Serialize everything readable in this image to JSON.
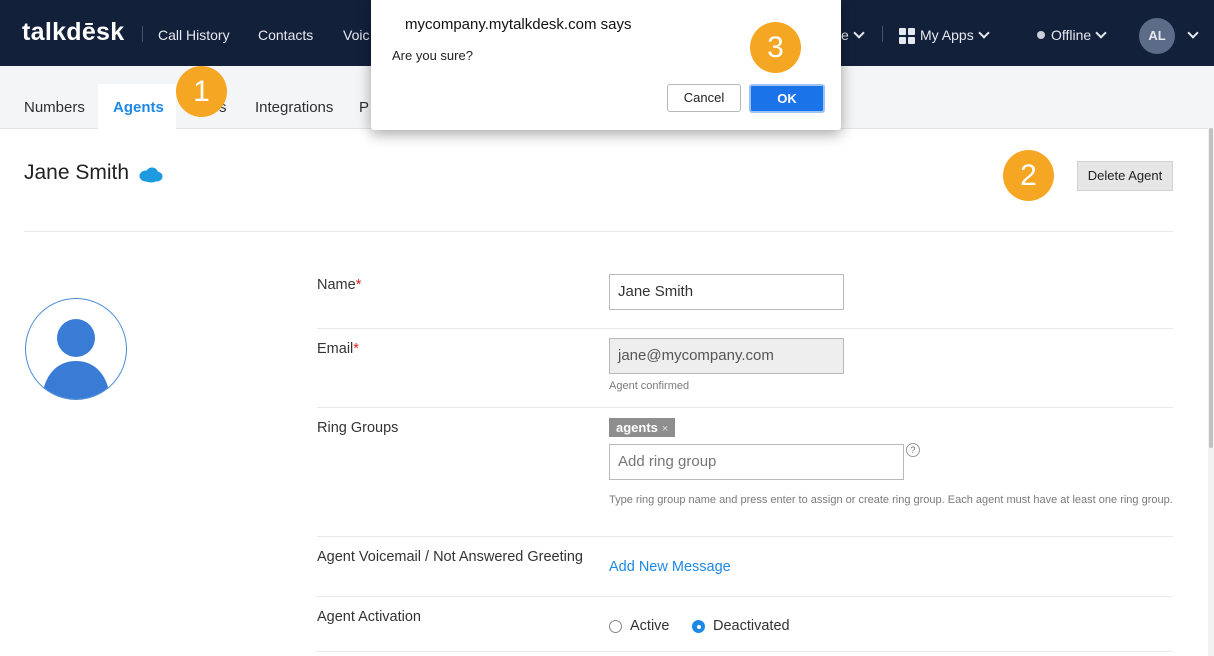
{
  "navbar": {
    "logo": "talkdēsk",
    "links": [
      "Call History",
      "Contacts",
      "Voic"
    ],
    "partial_link_end": "e",
    "apps_label": "My Apps",
    "status_label": "Offline",
    "user_initials": "AL"
  },
  "subtabs": {
    "items": [
      "Numbers",
      "Agents",
      "s",
      "Integrations",
      "P"
    ],
    "active": "Agents"
  },
  "agent": {
    "title": "Jane Smith",
    "delete_label": "Delete Agent"
  },
  "form": {
    "name_label": "Name",
    "name_value": "Jane Smith",
    "email_label": "Email",
    "email_value": "jane@mycompany.com",
    "email_hint": "Agent confirmed",
    "required_mark": "*",
    "ring_groups_label": "Ring Groups",
    "ring_group_tag": "agents",
    "ring_group_tag_remove": "×",
    "ring_group_placeholder": "Add ring group",
    "help_mark": "?",
    "ring_group_hint": "Type ring group name and press enter to assign or create ring group. Each agent must have at least one ring group.",
    "voicemail_label": "Agent Voicemail / Not Answered Greeting",
    "add_message_link": "Add New Message",
    "activation_label": "Agent Activation",
    "activation_options": [
      "Active",
      "Deactivated"
    ],
    "activation_selected": "Deactivated"
  },
  "dialog": {
    "title": "mycompany.mytalkdesk.com says",
    "message": "Are you sure?",
    "cancel_label": "Cancel",
    "ok_label": "OK"
  },
  "step_badges": [
    "1",
    "2",
    "3"
  ],
  "colors": {
    "navbar_bg": "#13203a",
    "accent_blue": "#1e88e5",
    "badge_orange": "#f5a623",
    "ok_button": "#1a73e8"
  }
}
